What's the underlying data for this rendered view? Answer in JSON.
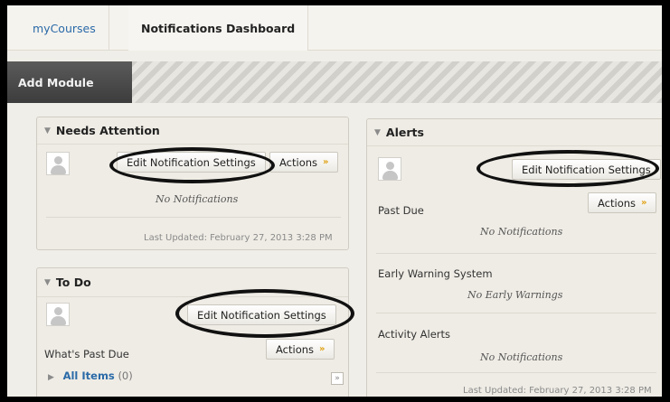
{
  "breadcrumb": {
    "courses": "myCourses",
    "current": "Notifications Dashboard"
  },
  "toolbar": {
    "add_module": "Add Module"
  },
  "needs_attention": {
    "title": "Needs Attention",
    "edit_settings": "Edit Notification Settings",
    "actions": "Actions",
    "empty": "No Notifications",
    "last_updated": "Last Updated: February 27, 2013 3:28 PM"
  },
  "todo": {
    "title": "To Do",
    "edit_settings": "Edit Notification Settings",
    "actions": "Actions",
    "past_due": "What's Past Due",
    "all_items": "All Items",
    "all_items_count": "(0)"
  },
  "alerts": {
    "title": "Alerts",
    "edit_settings": "Edit Notification Settings",
    "actions": "Actions",
    "past_due": "Past Due",
    "past_due_empty": "No Notifications",
    "early_warning": "Early Warning System",
    "early_warning_empty": "No Early Warnings",
    "activity": "Activity Alerts",
    "activity_empty": "No Notifications",
    "last_updated": "Last Updated: February 27, 2013 3:28 PM"
  },
  "icons": {
    "collapse": "triangle-down-icon",
    "chevron": "chevron-down-icon",
    "avatar": "user-avatar-icon"
  },
  "colors": {
    "link": "#2a6aa8",
    "chevron": "#e0a010",
    "annotation": "#111111"
  }
}
